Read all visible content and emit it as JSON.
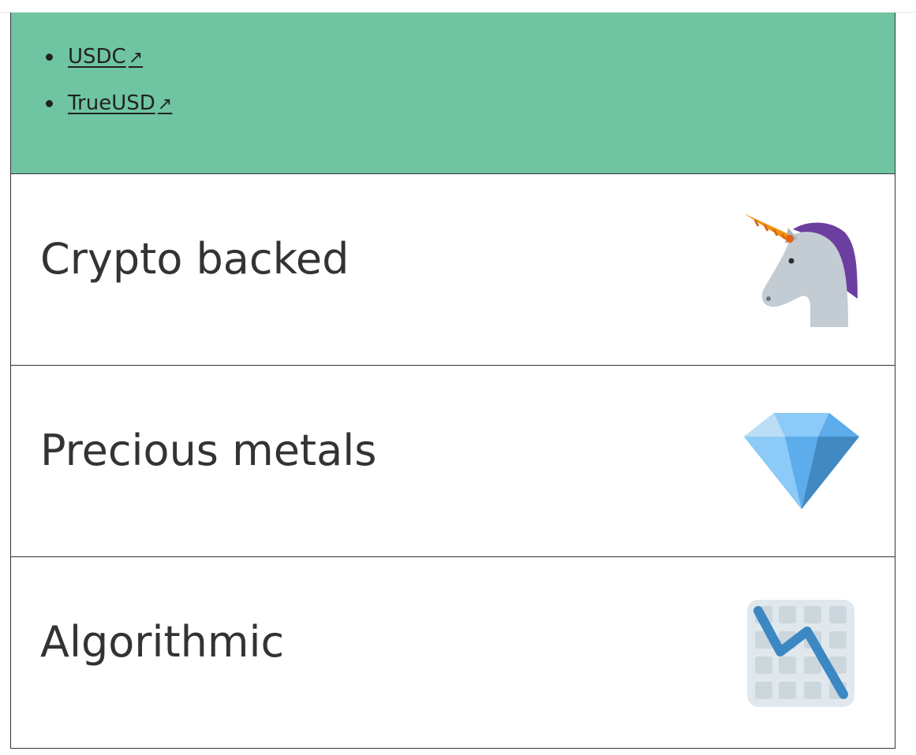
{
  "links": [
    {
      "label": "USDC",
      "ext": "↗"
    },
    {
      "label": "TrueUSD",
      "ext": "↗"
    }
  ],
  "cards": [
    {
      "title": "Crypto backed",
      "icon": "unicorn-icon"
    },
    {
      "title": "Precious metals",
      "icon": "gem-icon"
    },
    {
      "title": "Algorithmic",
      "icon": "chart-decreasing-icon"
    }
  ],
  "colors": {
    "panel_green": "#6fc5a1",
    "text": "#333333",
    "border": "#333333"
  }
}
